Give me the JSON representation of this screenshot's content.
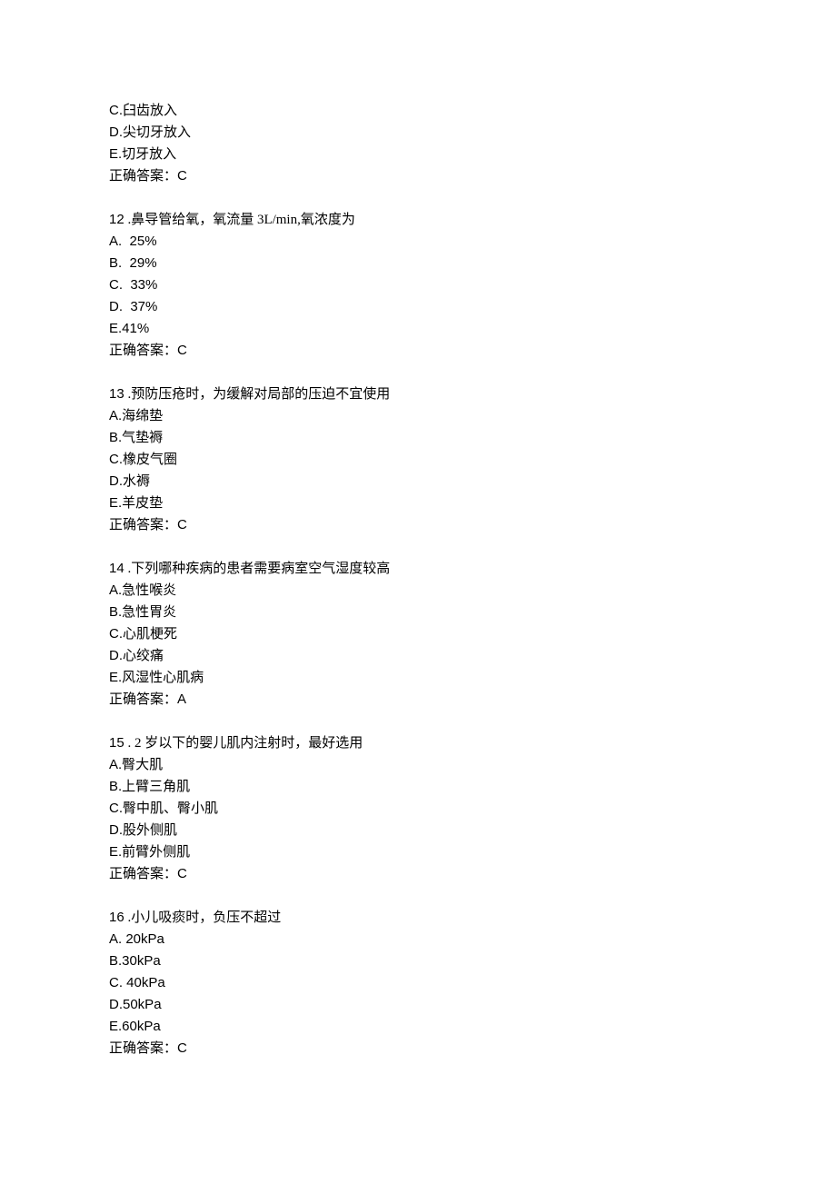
{
  "preamble": {
    "lines": [
      "C.臼齿放入",
      "D.尖切牙放入",
      "E.切牙放入"
    ],
    "answer_label": "正确答案：",
    "answer_value": "C"
  },
  "questions": [
    {
      "number": "12",
      "stem": " .鼻导管给氧，氧流量 3L/min,氧浓度为",
      "options": [
        "A.  25%",
        "B.  29%",
        "C.  33%",
        "D.  37%",
        "E.41%"
      ],
      "answer_label": "正确答案：",
      "answer_value": "C"
    },
    {
      "number": "13",
      "stem": " .预防压疮时，为缓解对局部的压迫不宜使用",
      "options": [
        "A.海绵垫",
        "B.气垫褥",
        "C.橡皮气圈",
        "D.水褥",
        "E.羊皮垫"
      ],
      "answer_label": "正确答案：",
      "answer_value": "C"
    },
    {
      "number": "14",
      "stem": " .下列哪种疾病的患者需要病室空气湿度较高",
      "options": [
        "A.急性喉炎",
        "B.急性胃炎",
        "C.心肌梗死",
        "D.心绞痛",
        "E.风湿性心肌病"
      ],
      "answer_label": "正确答案：",
      "answer_value": "A"
    },
    {
      "number": "15",
      "stem": " . 2 岁以下的婴儿肌内注射时，最好选用",
      "options": [
        "A.臀大肌",
        "B.上臂三角肌",
        "C.臀中肌、臀小肌",
        "D.股外侧肌",
        "E.前臂外侧肌"
      ],
      "answer_label": "正确答案：",
      "answer_value": "C"
    },
    {
      "number": "16",
      "stem": " .小儿吸痰时，负压不超过",
      "options": [
        "A. 20kPa",
        "B.30kPa",
        "C. 40kPa",
        "D.50kPa",
        "E.60kPa"
      ],
      "answer_label": "正确答案：",
      "answer_value": "C"
    }
  ]
}
